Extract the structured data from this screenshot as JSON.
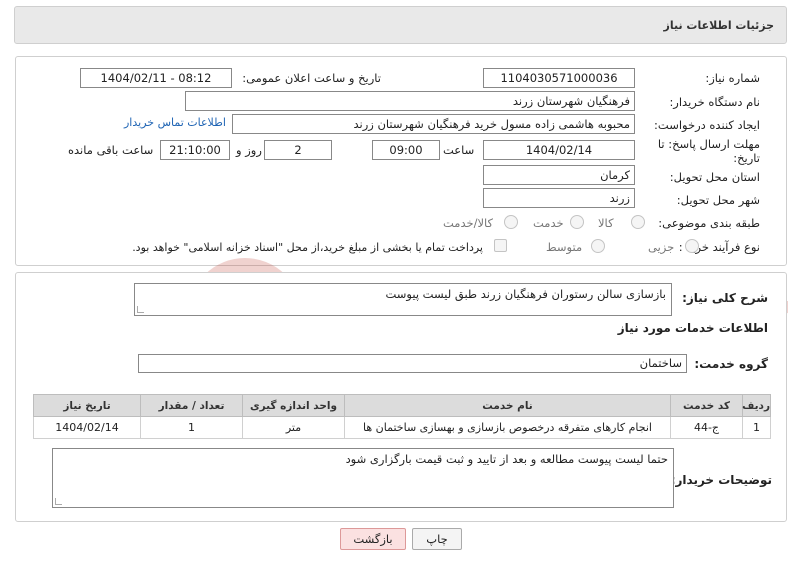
{
  "header": {
    "title": "جزئیات اطلاعات نیاز"
  },
  "form": {
    "need_number_label": "شماره نیاز:",
    "need_number": "1104030571000036",
    "announce_label": "تاریخ و ساعت اعلان عمومی:",
    "announce_value": "1404/02/11 - 08:12",
    "buyer_org_label": "نام دستگاه خریدار:",
    "buyer_org": "فرهنگیان شهرستان زرند",
    "creator_label": "ایجاد کننده درخواست:",
    "creator": "محبوبه هاشمی زاده مسول خرید فرهنگیان شهرستان زرند",
    "contact_link": "اطلاعات تماس خریدار",
    "deadline_label": "مهلت ارسال پاسخ: تا تاریخ:",
    "deadline_date": "1404/02/14",
    "time_label": "ساعت",
    "deadline_time": "09:00",
    "days_value": "2",
    "days_label": "روز و",
    "remaining_time": "21:10:00",
    "remaining_label": "ساعت باقی مانده",
    "province_label": "استان محل تحویل:",
    "province": "کرمان",
    "city_label": "شهر محل تحویل:",
    "city": "زرند",
    "category_label": "طبقه بندی موضوعی:",
    "category_options": [
      "کالا",
      "خدمت",
      "کالا/خدمت"
    ],
    "process_label": "نوع فرآیند خرید :",
    "process_options": [
      "جزیی",
      "متوسط"
    ],
    "payment_note": "پرداخت تمام یا بخشی از مبلغ خرید،از محل \"اسناد خزانه اسلامی\" خواهد بود."
  },
  "details": {
    "summary_label": "شرح کلی نیاز:",
    "summary": "بازسازی سالن رستوران فرهنگیان زرند طبق لیست پیوست",
    "services_title": "اطلاعات خدمات مورد نیاز",
    "service_group_label": "گروه خدمت:",
    "service_group": "ساختمان",
    "table_headers": [
      "ردیف",
      "کد خدمت",
      "نام خدمت",
      "واحد اندازه گیری",
      "تعداد / مقدار",
      "تاریخ نیاز"
    ],
    "table_rows": [
      [
        "1",
        "ج-44",
        "انجام کارهای متفرقه درخصوص بازسازی و بهسازی ساختمان ها",
        "متر",
        "1",
        "1404/02/14"
      ]
    ],
    "buyer_notes_label": "توضیحات خریدار:",
    "buyer_notes": "حتما لیست پیوست مطالعه  و بعد از تایید و ثبت قیمت بارگزاری شود"
  },
  "buttons": {
    "print": "چاپ",
    "back": "بازگشت"
  },
  "colors": {
    "link": "#1f64b4",
    "watermark": "#c0392b",
    "back_bg": "#fbe1e1"
  }
}
